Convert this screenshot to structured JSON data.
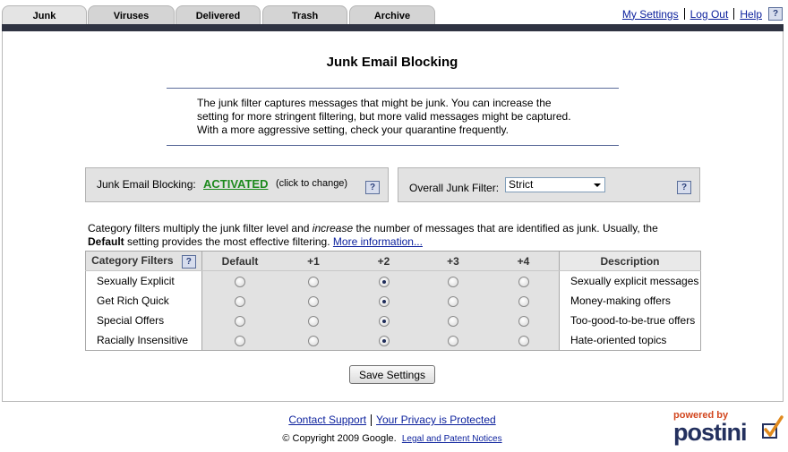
{
  "tabs": [
    {
      "label": "Junk",
      "active": true
    },
    {
      "label": "Viruses",
      "active": false
    },
    {
      "label": "Delivered",
      "active": false
    },
    {
      "label": "Trash",
      "active": false
    },
    {
      "label": "Archive",
      "active": false
    }
  ],
  "toplinks": {
    "settings": "My Settings",
    "logout": "Log Out",
    "help": "Help",
    "help_icon": "?"
  },
  "page_title": "Junk Email Blocking",
  "intro": {
    "line1": "The junk filter captures messages that might be junk. You can increase the",
    "line2": "setting for more stringent filtering, but more valid messages might be captured.",
    "line3": "With a more aggressive setting, check your quarantine frequently."
  },
  "blocking": {
    "label": "Junk Email Blocking:",
    "status": "ACTIVATED",
    "hint": "(click to change)",
    "help_icon": "?"
  },
  "overall_filter": {
    "label": "Overall Junk Filter:",
    "selected": "Strict",
    "help_icon": "?"
  },
  "category_desc": {
    "part1": "Category filters multiply the junk filter level and ",
    "emphasis": "increase",
    "part2": " the number of messages that are identified as junk. Usually, the",
    "strong": "Default",
    "part3": " setting provides the most effective filtering.",
    "more_link": "More information..."
  },
  "grid": {
    "category_header": "Category Filters",
    "help_icon": "?",
    "levels": [
      "Default",
      "+1",
      "+2",
      "+3",
      "+4"
    ],
    "description_header": "Description",
    "rows": [
      {
        "category": "Sexually Explicit",
        "selected_level": "+2",
        "description": "Sexually explicit messages"
      },
      {
        "category": "Get Rich Quick",
        "selected_level": "+2",
        "description": "Money-making offers"
      },
      {
        "category": "Special Offers",
        "selected_level": "+2",
        "description": "Too-good-to-be-true offers"
      },
      {
        "category": "Racially Insensitive",
        "selected_level": "+2",
        "description": "Hate-oriented topics"
      }
    ]
  },
  "save_button": "Save Settings",
  "footer": {
    "contact": "Contact Support",
    "privacy": "Your Privacy is Protected",
    "copyright": "© Copyright 2009 Google.",
    "legal": "Legal and Patent Notices"
  },
  "logo": {
    "powered_by": "powered by",
    "brand": "postini"
  },
  "colors": {
    "accent_bar": "#2f3342",
    "activated": "#1d8a1d",
    "link": "#0a1f9c",
    "brand_orange": "#d2461e",
    "brand_navy": "#23305e"
  }
}
